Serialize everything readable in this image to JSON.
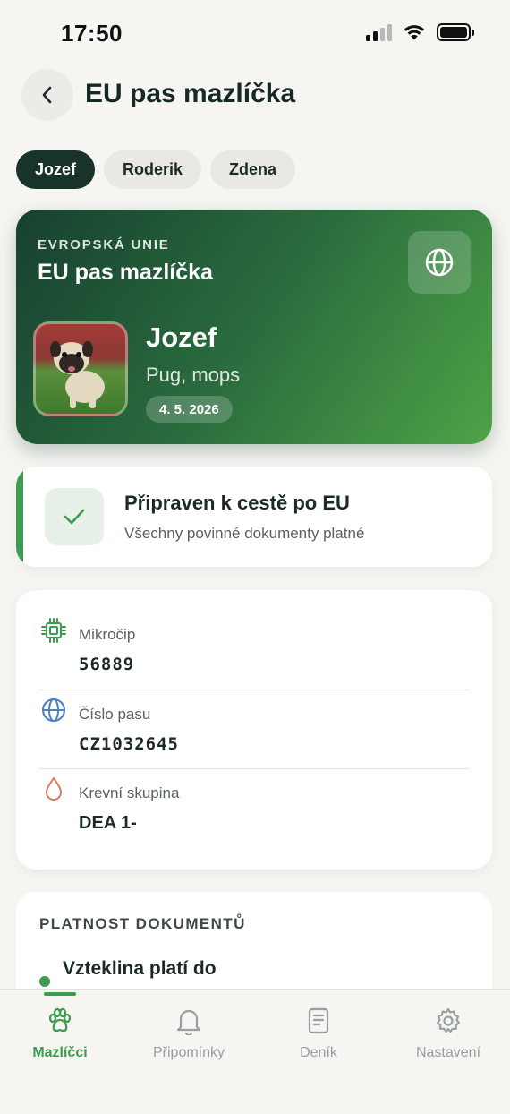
{
  "status_bar": {
    "time": "17:50"
  },
  "header": {
    "title": "EU pas mazlíčka"
  },
  "pets": [
    {
      "name": "Jozef",
      "active": true
    },
    {
      "name": "Roderik",
      "active": false
    },
    {
      "name": "Zdena",
      "active": false
    }
  ],
  "passport": {
    "eyebrow": "EVROPSKÁ UNIE",
    "title": "EU pas mazlíčka",
    "pet_name": "Jozef",
    "breed": "Pug, mops",
    "date": "4. 5. 2026"
  },
  "travel_status": {
    "title": "Připraven k cestě po EU",
    "subtitle": "Všechny povinné dokumenty platné"
  },
  "info": {
    "microchip": {
      "label": "Mikročip",
      "value": "56889"
    },
    "passport_number": {
      "label": "Číslo pasu",
      "value": "CZ1032645"
    },
    "blood_type": {
      "label": "Krevní skupina",
      "value": "DEA 1-"
    }
  },
  "documents": {
    "heading": "PLATNOST DOKUMENTŮ",
    "items": [
      {
        "label": "Vzteklina platí do"
      }
    ]
  },
  "tabs": [
    {
      "label": "Mazlíčci",
      "icon": "paw-icon",
      "active": true
    },
    {
      "label": "Připomínky",
      "icon": "bell-icon",
      "active": false
    },
    {
      "label": "Deník",
      "icon": "document-icon",
      "active": false
    },
    {
      "label": "Nastavení",
      "icon": "gear-icon",
      "active": false
    }
  ],
  "colors": {
    "accent": "#3c9c4d",
    "dark_chip": "#18332a",
    "passport_gradient_start": "#17402f",
    "passport_gradient_end": "#4ea346",
    "passport_icon_blue": "#4a7fc9",
    "blood_icon": "#e07a5f"
  }
}
